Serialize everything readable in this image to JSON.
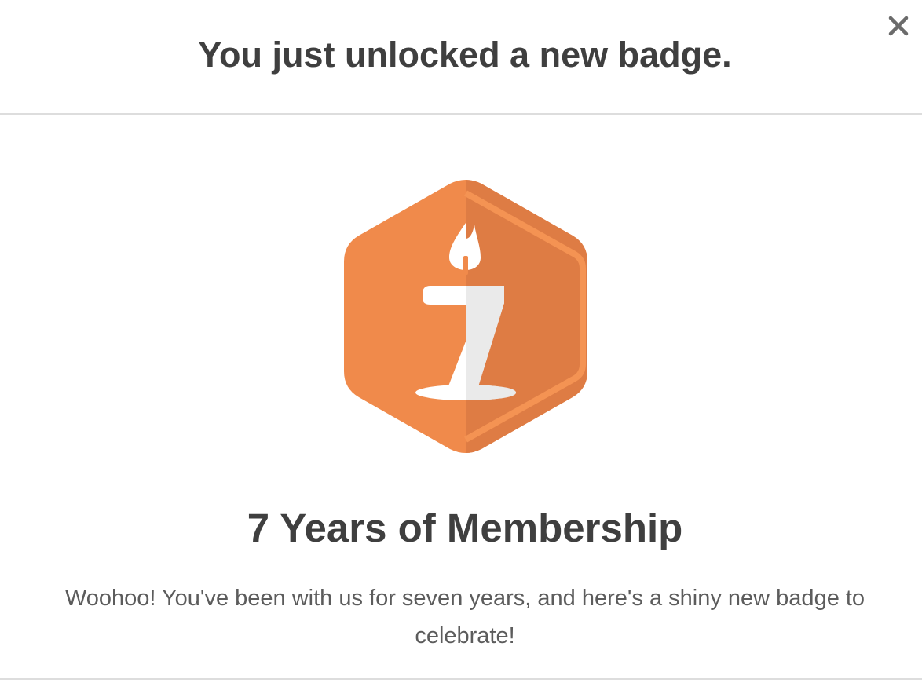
{
  "modal": {
    "title": "You just unlocked a new badge.",
    "close_icon": "close-icon"
  },
  "badge": {
    "icon": "candle-seven-hexagon-badge",
    "name": "7 Years of Membership",
    "description": "Woohoo! You've been with us for seven years, and here's a shiny new badge to celebrate!"
  },
  "colors": {
    "badge_orange": "#f08a4b",
    "badge_orange_shade": "#de7c44",
    "badge_rim": "#f49353",
    "candle_white": "#ffffff",
    "candle_shade": "#eaeaea",
    "heading_text": "#3f3f3f",
    "body_text": "#5c5c5c",
    "divider": "#dddddd",
    "close_icon": "#6b6b6b"
  }
}
